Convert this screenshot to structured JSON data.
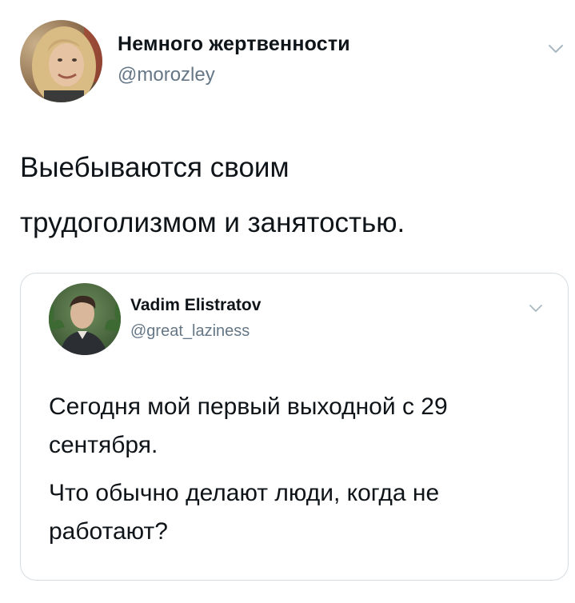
{
  "tweet": {
    "author": {
      "name": "Немного жертвенности",
      "handle": "@morozley"
    },
    "text_lines": [
      "Выебываются своим",
      "трудоголизмом и занятостью."
    ]
  },
  "quoted_tweet": {
    "author": {
      "name": "Vadim Elistratov",
      "handle": "@great_laziness"
    },
    "paragraphs": [
      "Сегодня мой первый выходной с 29 сентября.",
      "Что обычно делают люди, когда не работают?"
    ]
  },
  "icons": {
    "more_menu": "chevron-down-icon"
  },
  "colors": {
    "text": "#0f1419",
    "secondary_text": "#657786",
    "card_border": "#d5dde3",
    "chevron": "#aab8c2"
  }
}
